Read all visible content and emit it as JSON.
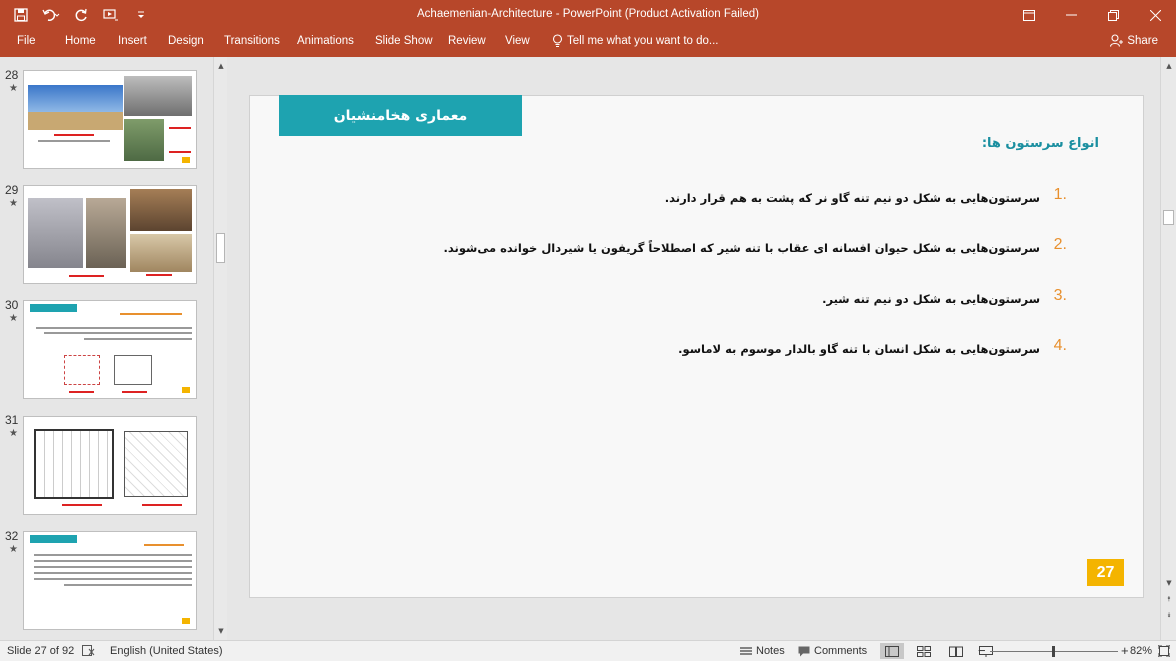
{
  "window": {
    "title": "Achaemenian-Architecture - PowerPoint (Product Activation Failed)"
  },
  "ribbon": {
    "tabs": [
      "File",
      "Home",
      "Insert",
      "Design",
      "Transitions",
      "Animations",
      "Slide Show",
      "Review",
      "View"
    ],
    "tell_me": "Tell me what you want to do...",
    "share": "Share"
  },
  "thumbnails": [
    {
      "number": "28",
      "star": "★"
    },
    {
      "number": "29",
      "star": "★"
    },
    {
      "number": "30",
      "star": "★"
    },
    {
      "number": "31",
      "star": "★"
    },
    {
      "number": "32",
      "star": "★"
    }
  ],
  "slide": {
    "header": "معماری هخامنشیان",
    "subtitle": "انواع سرستون ها:",
    "items": [
      {
        "number": "1.",
        "text": "سرستون‌هایی به شکل دو نیم تنه گاو نر که پشت به هم قرار دارند."
      },
      {
        "number": "2.",
        "text": "سرستون‌هایی به شکل حیوان افسانه ای عقاب با تنه شیر که اصطلاحاً گریفون یا شیردال خوانده می‌شوند."
      },
      {
        "number": "3.",
        "text": "سرستون‌هایی به شکل دو نیم تنه شیر."
      },
      {
        "number": "4.",
        "text": "سرستون‌هایی به شکل انسان با تنه گاو بالدار موسوم به لاماسو."
      }
    ],
    "page_number": "27"
  },
  "status": {
    "slide_info": "Slide 27 of 92",
    "language": "English (United States)",
    "notes": "Notes",
    "comments": "Comments",
    "zoom": "82%"
  },
  "colors": {
    "accent": "#b7472a",
    "teal": "#1ea3b0",
    "badge": "#f4b400",
    "number": "#e8902e"
  }
}
